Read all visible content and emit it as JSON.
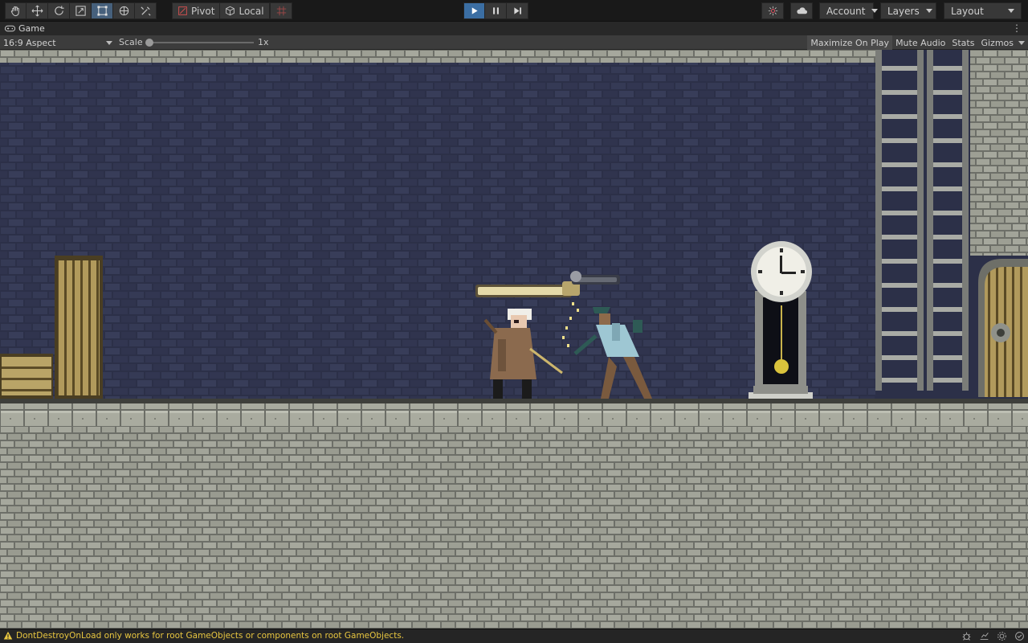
{
  "toolbar": {
    "tools": [
      {
        "icon": "hand-icon",
        "name": "view-tool"
      },
      {
        "icon": "move-icon",
        "name": "move-tool"
      },
      {
        "icon": "rotate-icon",
        "name": "rotate-tool"
      },
      {
        "icon": "scale-icon",
        "name": "scale-tool"
      },
      {
        "icon": "rect-icon",
        "name": "rect-tool"
      },
      {
        "icon": "transform-icon",
        "name": "transform-tool"
      },
      {
        "icon": "custom-tools-icon",
        "name": "custom-tool"
      }
    ],
    "pivot_label": "Pivot",
    "local_label": "Local",
    "account_label": "Account",
    "layers_label": "Layers",
    "layout_label": "Layout"
  },
  "tab": {
    "title": "Game"
  },
  "game_bar": {
    "aspect": "16:9 Aspect",
    "scale_label": "Scale",
    "scale_value": "1x",
    "scale_level": 0.0,
    "maximize_label": "Maximize On Play",
    "mute_label": "Mute Audio",
    "stats_label": "Stats",
    "gizmos_label": "Gizmos"
  },
  "game": {
    "player_health": 1.0,
    "enemy_health": 0.0
  },
  "status": {
    "message": "DontDestroyOnLoad only works for root GameObjects or components on root GameObjects."
  },
  "colors": {
    "accent": "#3b6ea3",
    "warning": "#e8c640",
    "wall_dark": "#2b2f45",
    "stone": "#9fa195"
  }
}
